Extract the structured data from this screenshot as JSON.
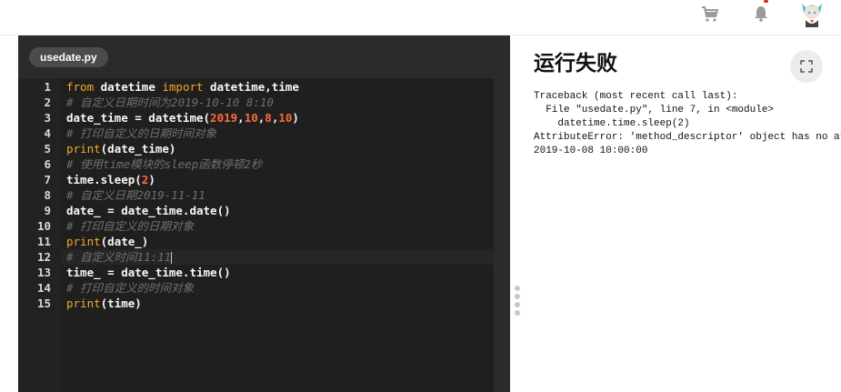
{
  "header": {
    "cart_icon": "cart-icon",
    "bell_icon": "bell-icon",
    "avatar": "avatar"
  },
  "editor": {
    "file_tab": "usedate.py",
    "active_line": 12,
    "lines": [
      {
        "num": "1"
      },
      {
        "num": "2"
      },
      {
        "num": "3"
      },
      {
        "num": "4"
      },
      {
        "num": "5"
      },
      {
        "num": "6"
      },
      {
        "num": "7"
      },
      {
        "num": "8"
      },
      {
        "num": "9"
      },
      {
        "num": "10"
      },
      {
        "num": "11"
      },
      {
        "num": "12"
      },
      {
        "num": "13"
      },
      {
        "num": "14"
      },
      {
        "num": "15"
      }
    ],
    "code": {
      "l1_kw1": "from",
      "l1_a": " datetime ",
      "l1_kw2": "import",
      "l1_b": " datetime,time",
      "l2": "# 自定义日期时间为2019-10-10 8:10",
      "l3_a": "date_time = datetime(",
      "l3_n1": "2019",
      "l3_c1": ",",
      "l3_n2": "10",
      "l3_c2": ",",
      "l3_n3": "8",
      "l3_c3": ",",
      "l3_n4": "10",
      "l3_b": ")",
      "l4": "# 打印自定义的日期时间对象",
      "l5_fn": "print",
      "l5_a": "(date_time)",
      "l6": "# 使用time模块的sleep函数停顿2秒",
      "l7_a": "time.sleep(",
      "l7_n": "2",
      "l7_b": ")",
      "l8": "# 自定义日期2019-11-11",
      "l9": "date_ = date_time.date()",
      "l10": "# 打印自定义的日期对象",
      "l11_fn": "print",
      "l11_a": "(date_)",
      "l12": "# 自定义时间11:11",
      "l13": "time_ = date_time.time()",
      "l14": "# 打印自定义的时间对象",
      "l15_fn": "print",
      "l15_a": "(time)"
    }
  },
  "output": {
    "title": "运行失败",
    "expand_icon": "expand-icon",
    "traceback": "Traceback (most recent call last):\n  File \"usedate.py\", line 7, in <module>\n    datetime.time.sleep(2)\nAttributeError: 'method_descriptor' object has no attribute 'sleep'\n2019-10-08 10:00:00"
  }
}
